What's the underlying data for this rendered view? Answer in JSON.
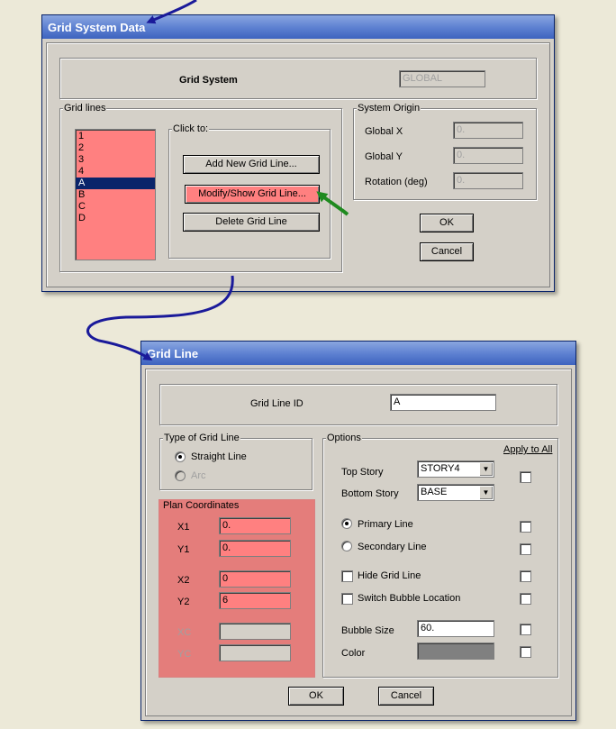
{
  "grid_system_window": {
    "title": "Grid System Data",
    "grid_system_label": "Grid System",
    "grid_system_value": "GLOBAL",
    "grid_lines_legend": "Grid lines",
    "grid_lines": [
      "1",
      "2",
      "3",
      "4",
      "A",
      "B",
      "C",
      "D"
    ],
    "selected_line": "A",
    "click_to_legend": "Click to:",
    "add_button": "Add New Grid Line...",
    "modify_button": "Modify/Show Grid Line...",
    "delete_button": "Delete Grid Line",
    "origin_legend": "System Origin",
    "global_x_label": "Global X",
    "global_x_value": "0.",
    "global_y_label": "Global Y",
    "global_y_value": "0.",
    "rotation_label": "Rotation  (deg)",
    "rotation_value": "0.",
    "ok_button": "OK",
    "cancel_button": "Cancel"
  },
  "grid_line_window": {
    "title": "Grid Line",
    "id_label": "Grid Line ID",
    "id_value": "A",
    "type_legend": "Type of Grid Line",
    "straight_line": "Straight Line",
    "arc": "Arc",
    "plan_coords_legend": "Plan Coordinates",
    "x1_label": "X1",
    "x1_value": "0.",
    "y1_label": "Y1",
    "y1_value": "0.",
    "x2_label": "X2",
    "x2_value": "0",
    "y2_label": "Y2",
    "y2_value": "6",
    "xc_label": "XC",
    "xc_value": "",
    "yc_label": "YC",
    "yc_value": "",
    "options_legend": "Options",
    "apply_to_all": "Apply to All",
    "top_story_label": "Top Story",
    "top_story_value": "STORY4",
    "bottom_story_label": "Bottom Story",
    "bottom_story_value": "BASE",
    "primary_line": "Primary Line",
    "secondary_line": "Secondary Line",
    "hide_grid_line": "Hide Grid Line",
    "switch_bubble": "Switch Bubble Location",
    "bubble_size_label": "Bubble Size",
    "bubble_size_value": "60.",
    "color_label": "Color",
    "color_value": "#808080",
    "ok_button": "OK",
    "cancel_button": "Cancel"
  },
  "colors": {
    "highlight_pink": "#ff8080",
    "selection_navy": "#0a246a",
    "arrow_blue": "#1a1a9a",
    "arrow_green": "#1f8a1f"
  }
}
